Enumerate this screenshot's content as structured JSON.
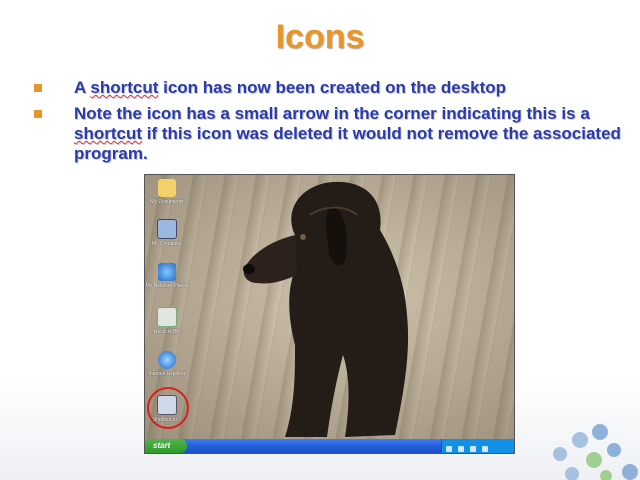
{
  "slide": {
    "title": "Icons",
    "bullets": [
      {
        "text": "A shortcut icon has now been created on the desktop"
      },
      {
        "text": "Note the icon has a small arrow in the corner indicating this is a shortcut if this icon was deleted it would not remove the associated program."
      }
    ]
  },
  "desktop": {
    "start_label": "start",
    "icons": [
      {
        "name": "documents-icon",
        "label": "My Documents"
      },
      {
        "name": "computer-icon",
        "label": "My Computer"
      },
      {
        "name": "network-icon",
        "label": "My Network Places"
      },
      {
        "name": "recycle-bin-icon",
        "label": "Recycle Bin"
      },
      {
        "name": "internet-explorer-icon",
        "label": "Internet Explorer"
      },
      {
        "name": "shortcut-icon",
        "label": "Shortcut to..."
      }
    ]
  },
  "colors": {
    "title": "#e8962a",
    "bullet_text": "#2b3aa8",
    "bullet_marker": "#e8962a",
    "highlight_circle": "#d82020"
  }
}
